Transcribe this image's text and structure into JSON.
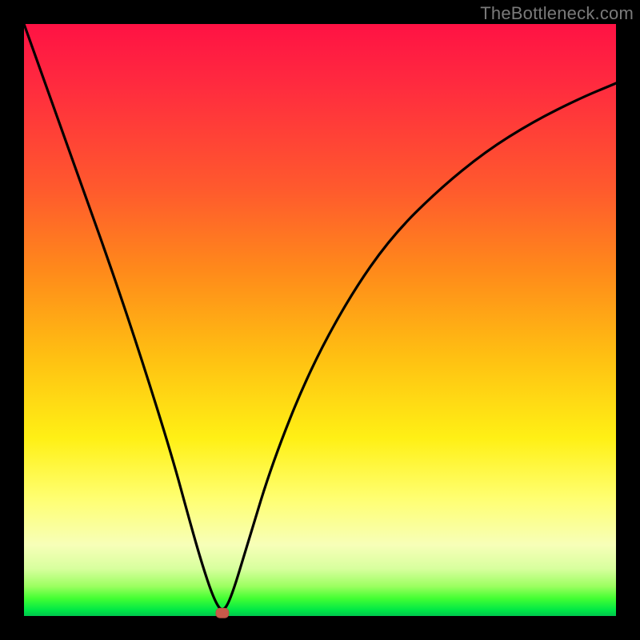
{
  "watermark": "TheBottleneck.com",
  "chart_data": {
    "type": "line",
    "title": "",
    "xlabel": "",
    "ylabel": "",
    "xlim": [
      0,
      100
    ],
    "ylim": [
      0,
      100
    ],
    "grid": false,
    "legend": false,
    "series": [
      {
        "name": "bottleneck-curve",
        "x": [
          0,
          5,
          10,
          15,
          20,
          25,
          28,
          30,
          32,
          33.5,
          35,
          38,
          42,
          48,
          55,
          62,
          70,
          78,
          86,
          94,
          100
        ],
        "y": [
          100,
          86,
          72,
          58,
          43,
          27,
          16,
          9,
          3,
          0.5,
          3,
          13,
          26,
          41,
          54,
          64,
          72,
          78.5,
          83.5,
          87.5,
          90
        ]
      }
    ],
    "marker": {
      "x": 33.5,
      "y": 0.5,
      "shape": "rounded-rect",
      "color": "#c85a4a"
    },
    "background_gradient": {
      "direction": "vertical",
      "stops": [
        {
          "pos": 0.0,
          "color": "#ff1244"
        },
        {
          "pos": 0.28,
          "color": "#ff5a2d"
        },
        {
          "pos": 0.56,
          "color": "#ffbf12"
        },
        {
          "pos": 0.8,
          "color": "#ffff70"
        },
        {
          "pos": 0.95,
          "color": "#9bff60"
        },
        {
          "pos": 1.0,
          "color": "#00c74e"
        }
      ]
    }
  }
}
